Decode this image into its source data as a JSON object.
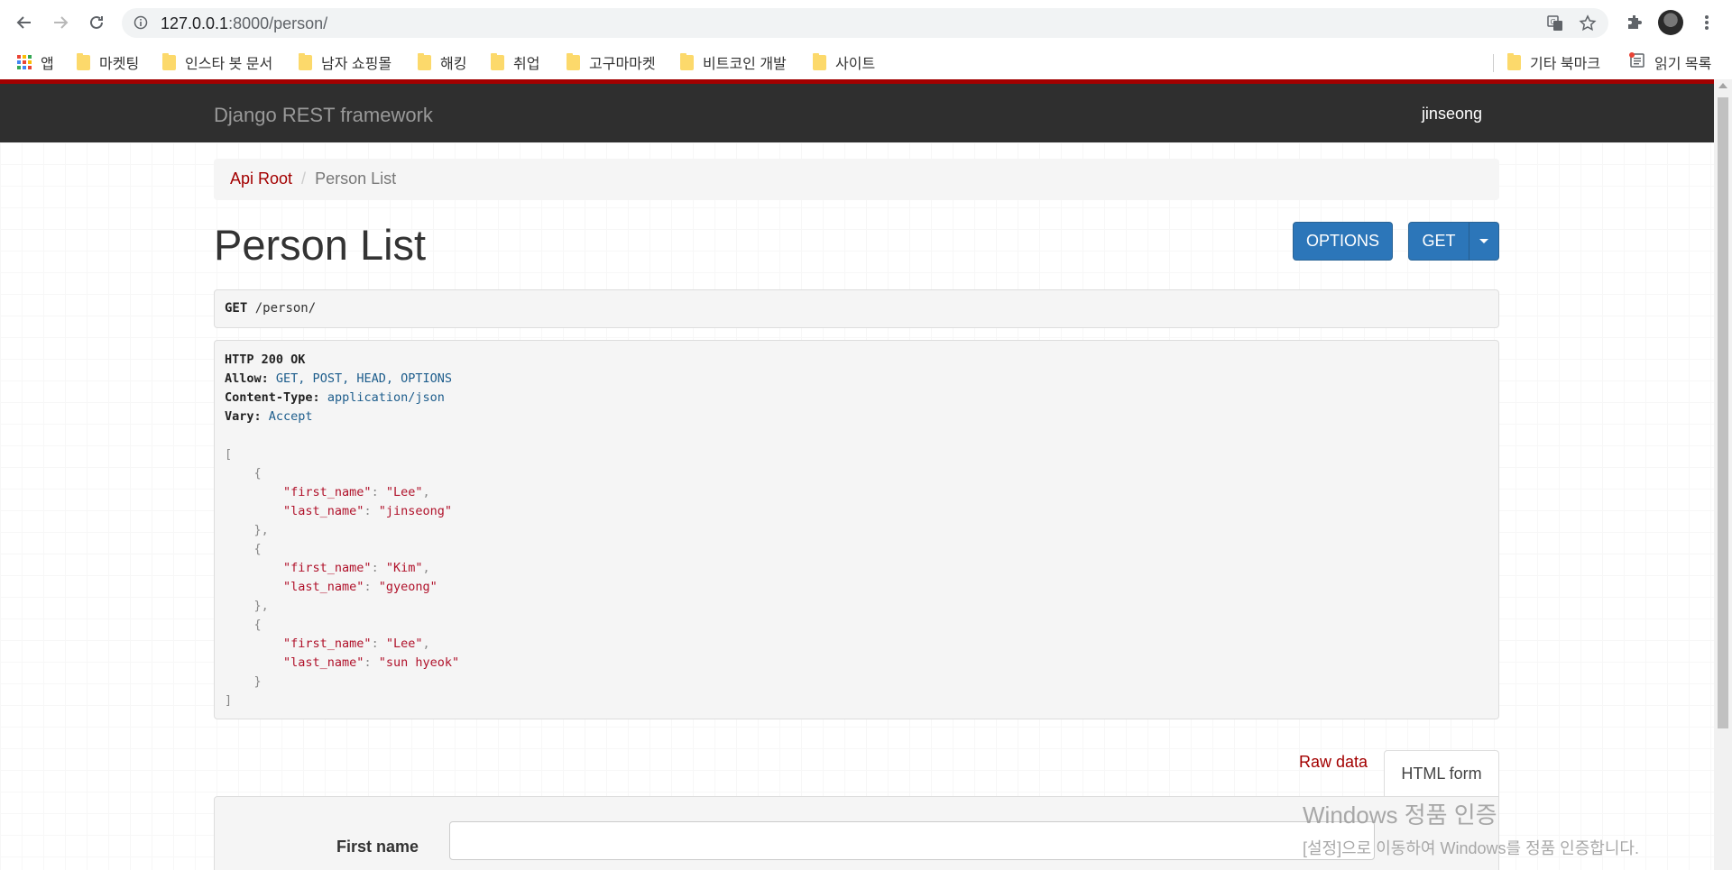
{
  "browser": {
    "url_host": "127.0.0.1",
    "url_path": ":8000/person/",
    "bookmarks": [
      {
        "label": "앱",
        "type": "apps"
      },
      {
        "label": "마켓팅",
        "type": "folder"
      },
      {
        "label": "인스타 봇 문서",
        "type": "folder"
      },
      {
        "label": "남자 쇼핑몰",
        "type": "folder"
      },
      {
        "label": "해킹",
        "type": "folder"
      },
      {
        "label": "취업",
        "type": "folder"
      },
      {
        "label": "고구마마켓",
        "type": "folder"
      },
      {
        "label": "비트코인 개발",
        "type": "folder"
      },
      {
        "label": "사이트",
        "type": "folder"
      }
    ],
    "bookmarks_right": [
      {
        "label": "기타 북마크",
        "type": "folder"
      },
      {
        "label": "읽기 목록",
        "type": "reading-list"
      }
    ]
  },
  "navbar": {
    "brand": "Django REST framework",
    "user": "jinseong"
  },
  "breadcrumb": {
    "root": "Api Root",
    "separator": "/",
    "current": "Person List"
  },
  "page": {
    "title": "Person List",
    "options_label": "OPTIONS",
    "get_label": "GET"
  },
  "request": {
    "method": "GET",
    "path": "/person/"
  },
  "response": {
    "status": "HTTP 200 OK",
    "headers": [
      {
        "name": "Allow:",
        "value": "GET, POST, HEAD, OPTIONS"
      },
      {
        "name": "Content-Type:",
        "value": "application/json"
      },
      {
        "name": "Vary:",
        "value": "Accept"
      }
    ],
    "body": [
      {
        "first_name": "Lee",
        "last_name": "jinseong"
      },
      {
        "first_name": "Kim",
        "last_name": "gyeong"
      },
      {
        "first_name": "Lee",
        "last_name": "sun hyeok"
      }
    ]
  },
  "tabs": {
    "raw": "Raw data",
    "form": "HTML form"
  },
  "form": {
    "first_name_label": "First name",
    "first_name_value": ""
  },
  "watermark": {
    "line1": "Windows 정품 인증",
    "line2": "[설정]으로 이동하여 Windows를 정품 인증합니다."
  },
  "colors": {
    "accent_red": "#a30000",
    "button_blue": "#2c76b9",
    "navbar": "#2f2f2f"
  }
}
